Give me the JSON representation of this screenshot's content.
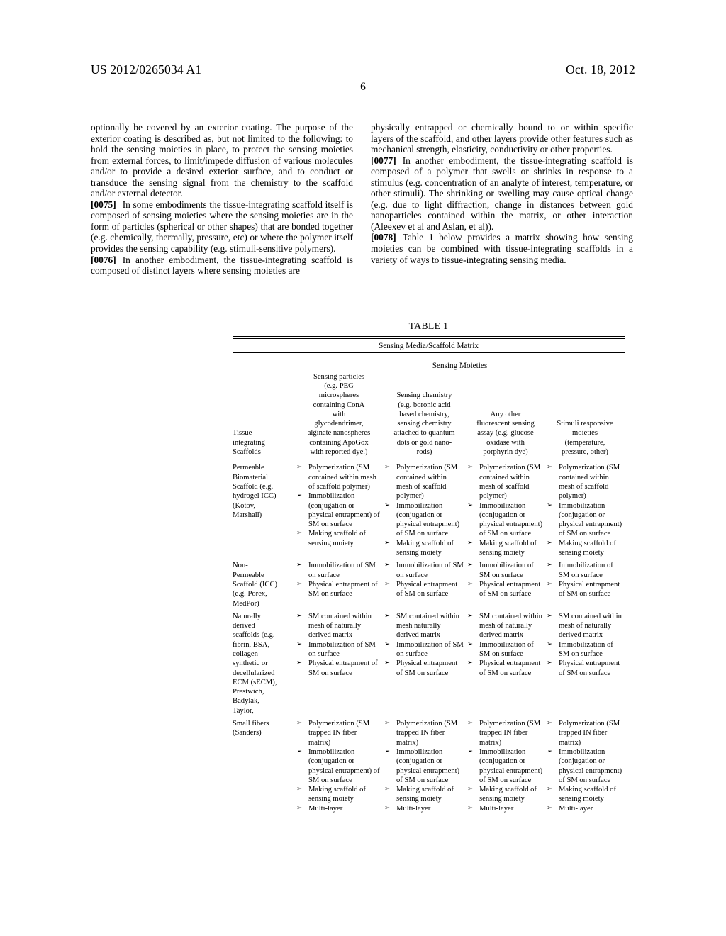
{
  "header": {
    "publication_number": "US 2012/0265034 A1",
    "publication_date": "Oct. 18, 2012",
    "page_number": "6"
  },
  "body": {
    "left_column": [
      {
        "number": "",
        "text": "optionally be covered by an exterior coating. The purpose of the exterior coating is described as, but not limited to the following: to hold the sensing moieties in place, to protect the sensing moieties from external forces, to limit/impede diffusion of various molecules and/or to provide a desired exterior surface, and to conduct or transduce the sensing signal from the chemistry to the scaffold and/or external detector."
      },
      {
        "number": "[0075]",
        "text": "In some embodiments the tissue-integrating scaffold itself is composed of sensing moieties where the sensing moieties are in the form of particles (spherical or other shapes) that are bonded together (e.g. chemically, thermally, pressure, etc) or where the polymer itself provides the sensing capability (e.g. stimuli-sensitive polymers)."
      },
      {
        "number": "[0076]",
        "text": "In another embodiment, the tissue-integrating scaffold is composed of distinct layers where sensing moieties are"
      }
    ],
    "right_column": [
      {
        "number": "",
        "text": "physically entrapped or chemically bound to or within specific layers of the scaffold, and other layers provide other features such as mechanical strength, elasticity, conductivity or other properties."
      },
      {
        "number": "[0077]",
        "text": "In another embodiment, the tissue-integrating scaffold is composed of a polymer that swells or shrinks in response to a stimulus (e.g. concentration of an analyte of interest, temperature, or other stimuli). The shrinking or swelling may cause optical change (e.g. due to light diffraction, change in distances between gold nanoparticles contained within the matrix, or other interaction (Aleexev et al and Aslan, et al))."
      },
      {
        "number": "[0078]",
        "text": "Table 1 below provides a matrix showing how sensing moieties can be combined with tissue-integrating scaffolds in a variety of ways to tissue-integrating sensing media."
      }
    ]
  },
  "table": {
    "caption": "TABLE 1",
    "banner": "Sensing Media/Scaffold Matrix",
    "sub_banner": "Sensing Moieties",
    "bullet_glyph": "➢",
    "columns": [
      "Tissue-integrating Scaffolds",
      "Sensing particles (e.g. PEG microspheres containing ConA with glycodendrimer, alginate nanospheres containing ApoGox with reported dye.)",
      "Sensing chemistry (e.g. boronic acid based chemistry, sensing chemistry attached to quantum dots or gold nano-rods)",
      "Any other fluorescent sensing assay (e.g. glucose oxidase with porphyrin dye)",
      "Stimuli responsive moieties (temperature, pressure, other)"
    ],
    "column_lines": [
      [
        "Tissue-",
        "integrating",
        "Scaffolds"
      ],
      [
        "Sensing particles",
        "(e.g. PEG",
        "microspheres",
        "containing ConA",
        "with",
        "glycodendrimer,",
        "alginate nanospheres",
        "containing ApoGox",
        "with reported dye.)"
      ],
      [
        "Sensing chemistry",
        "(e.g. boronic acid",
        "based chemistry,",
        "sensing chemistry",
        "attached to quantum",
        "dots or gold nano-",
        "rods)"
      ],
      [
        "Any other",
        "fluorescent sensing",
        "assay (e.g. glucose",
        "oxidase with",
        "porphyrin dye)"
      ],
      [
        "Stimuli responsive",
        "moieties",
        "(temperature,",
        "pressure, other)"
      ]
    ],
    "rows": [
      {
        "scaffold": "Permeable Biomaterial Scaffold (e.g. hydrogel ICC) (Kotov, Marshall)",
        "cells": [
          [
            "Polymerization (SM contained within mesh of scaffold polymer)",
            "Immobilization (conjugation or physical entrapment) of SM on surface",
            "Making scaffold of sensing moiety"
          ],
          [
            "Polymerization (SM contained within mesh of scaffold polymer)",
            "Immobilization (conjugation or physical entrapment) of SM on surface",
            "Making scaffold of sensing moiety"
          ],
          [
            "Polymerization (SM contained within mesh of scaffold polymer)",
            "Immobilization (conjugation or physical entrapment) of SM on surface",
            "Making scaffold of sensing moiety"
          ],
          [
            "Polymerization (SM contained within mesh of scaffold polymer)",
            "Immobilization (conjugation or physical entrapment) of SM on surface",
            "Making scaffold of sensing moiety"
          ]
        ]
      },
      {
        "scaffold": "Non-Permeable Scaffold (ICC) (e.g. Porex, MedPor)",
        "cells": [
          [
            "Immobilization of SM on surface",
            "Physical entrapment of SM on surface"
          ],
          [
            "Immobilization of SM on surface",
            "Physical entrapment of SM on surface"
          ],
          [
            "Immobilization of SM on surface",
            "Physical entrapment of SM on surface"
          ],
          [
            "Immobilization of SM on surface",
            "Physical entrapment of SM on surface"
          ]
        ]
      },
      {
        "scaffold": "Naturally derived scaffolds (e.g. fibrin, BSA, collagen synthetic or decellularized ECM (sECM), Prestwich, Badylak, Taylor,",
        "cells": [
          [
            "SM contained within mesh of naturally derived matrix",
            "Immobilization of SM on surface",
            "Physical entrapment of SM on surface"
          ],
          [
            "SM contained within mesh naturally derived matrix",
            "Immobilization of SM on surface",
            "Physical entrapment of SM on surface"
          ],
          [
            "SM contained within mesh of naturally derived matrix",
            "Immobilization of SM on surface",
            "Physical entrapment of SM on surface"
          ],
          [
            "SM contained within mesh of naturally derived matrix",
            "Immobilization of SM on surface",
            "Physical entrapment of SM on surface"
          ]
        ]
      },
      {
        "scaffold": "Small fibers (Sanders)",
        "cells": [
          [
            "Polymerization (SM trapped IN fiber matrix)",
            "Immobilization (conjugation or physical entrapment) of SM on surface",
            "Making scaffold of sensing moiety",
            "Multi-layer"
          ],
          [
            "Polymerization (SM trapped IN fiber matrix)",
            "Immobilization (conjugation or physical entrapment) of SM on surface",
            "Making scaffold of sensing moiety",
            "Multi-layer"
          ],
          [
            "Polymerization (SM trapped IN fiber matrix)",
            "Immobilization (conjugation or physical entrapment) of SM on surface",
            "Making scaffold of sensing moiety",
            "Multi-layer"
          ],
          [
            "Polymerization (SM trapped IN fiber matrix)",
            "Immobilization (conjugation or physical entrapment) of SM on surface",
            "Making scaffold of sensing moiety",
            "Multi-layer"
          ]
        ]
      }
    ],
    "scaffold_lines": [
      [
        "Permeable",
        "Biomaterial",
        "Scaffold (e.g.",
        "hydrogel ICC)",
        "(Kotov,",
        "Marshall)"
      ],
      [
        "Non-",
        "Permeable",
        "Scaffold (ICC)",
        "(e.g. Porex,",
        "MedPor)"
      ],
      [
        "Naturally",
        "derived",
        "scaffolds (e.g.",
        "fibrin, BSA,",
        "collagen",
        "synthetic or",
        "decellularized",
        "ECM (sECM),",
        "Prestwich,",
        "Badylak,",
        "Taylor,"
      ],
      [
        "Small fibers",
        "(Sanders)"
      ]
    ]
  }
}
